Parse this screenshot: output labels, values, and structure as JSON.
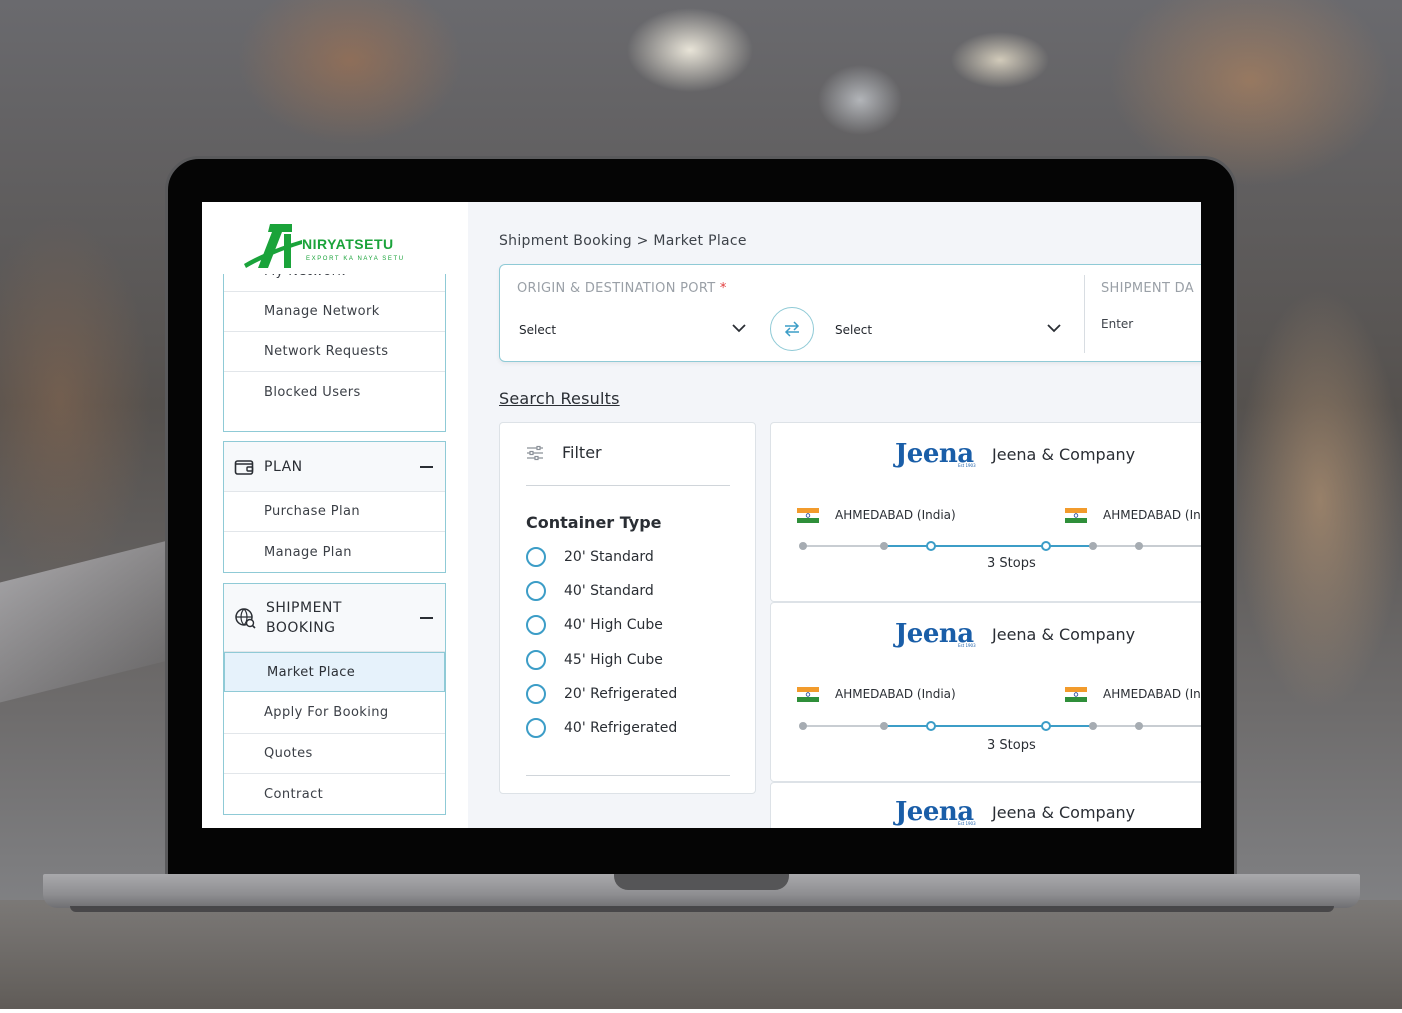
{
  "app": {
    "logo_text": "NIRYATSETU",
    "logo_tagline": "EXPORT KA NAYA SETU",
    "brand_color": "#1aa33a",
    "accent_color": "#8fcad6"
  },
  "sidebar": {
    "network_items": [
      "My Network",
      "Manage Network",
      "Network Requests",
      "Blocked Users"
    ],
    "plan": {
      "label": "PLAN",
      "icon": "wallet-icon",
      "items": [
        "Purchase Plan",
        "Manage Plan"
      ]
    },
    "shipment": {
      "label_line1": "SHIPMENT",
      "label_line2": "BOOKING",
      "icon": "globe-search-icon",
      "items": [
        "Market Place",
        "Apply For Booking",
        "Quotes",
        "Contract"
      ],
      "active_item": "Market Place"
    }
  },
  "main": {
    "breadcrumb": "Shipment Booking > Market Place",
    "search": {
      "port_label": "ORIGIN & DESTINATION PORT",
      "required_mark": "*",
      "origin_value": "Select",
      "destination_value": "Select",
      "date_label": "SHIPMENT DA",
      "date_value": "Enter"
    },
    "results_title": "Search Results",
    "filter": {
      "title": "Filter",
      "container_type_title": "Container Type",
      "options": [
        "20' Standard",
        "40' Standard",
        "40' High Cube",
        "45' High Cube",
        "20' Refrigerated",
        "40' Refrigerated"
      ]
    },
    "results": [
      {
        "logo": "Jeena",
        "logo_est": "Est 1903",
        "company": "Jeena & Company",
        "origin": "AHMEDABAD (India)",
        "destination": "AHMEDABAD (In",
        "stops": "3 Stops"
      },
      {
        "logo": "Jeena",
        "logo_est": "Est 1903",
        "company": "Jeena & Company",
        "origin": "AHMEDABAD (India)",
        "destination": "AHMEDABAD (In",
        "stops": "3 Stops"
      },
      {
        "logo": "Jeena",
        "logo_est": "Est 1903",
        "company": "Jeena & Company"
      }
    ]
  }
}
